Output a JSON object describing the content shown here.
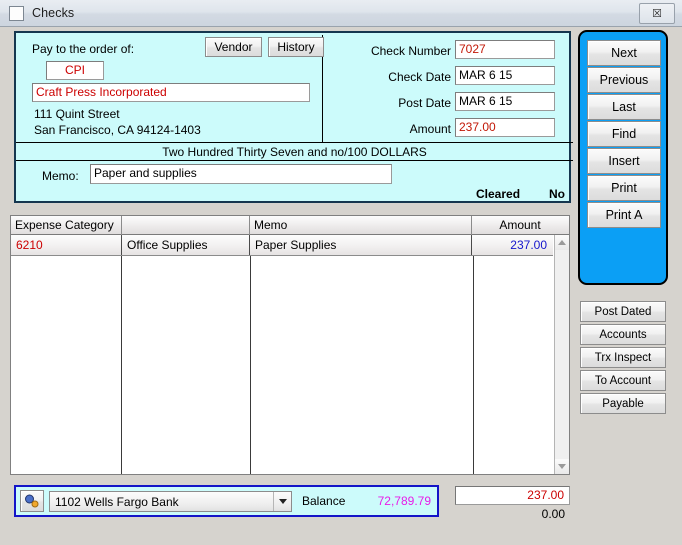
{
  "window": {
    "title": "Checks",
    "icon": "window-icon",
    "close_label": "☒"
  },
  "check": {
    "pay_to_label": "Pay to the order of:",
    "vendor_button": "Vendor",
    "history_button": "History",
    "vendor_code": "CPI",
    "payee_name": "Craft Press Incorporated",
    "address_line1": "111 Quint Street",
    "address_line2": "San Francisco, CA  94124-1403",
    "check_number_label": "Check Number",
    "check_number": "7027",
    "check_date_label": "Check Date",
    "check_date": "MAR 6 15",
    "post_date_label": "Post Date",
    "post_date": "MAR 6 15",
    "amount_label": "Amount",
    "amount": "237.00",
    "amount_words": "Two Hundred Thirty Seven and no/100 DOLLARS",
    "memo_label": "Memo:",
    "memo": "Paper and supplies",
    "cleared_label": "Cleared",
    "cleared_value": "No"
  },
  "nav_buttons": [
    {
      "label": "Next"
    },
    {
      "label": "Previous"
    },
    {
      "label": "Last"
    },
    {
      "label": "Find"
    },
    {
      "label": "Insert"
    },
    {
      "label": "Print"
    },
    {
      "label": "Print A"
    }
  ],
  "side_buttons": [
    {
      "label": "Post Dated"
    },
    {
      "label": "Accounts"
    },
    {
      "label": "Trx Inspect"
    },
    {
      "label": "To Account"
    },
    {
      "label": "Payable"
    }
  ],
  "grid": {
    "headers": [
      "Expense Category",
      "",
      "Memo",
      "Amount"
    ],
    "rows": [
      {
        "category": "6210",
        "category_name": "Office Supplies",
        "memo": "Paper Supplies",
        "amount": "237.00"
      }
    ]
  },
  "bottom": {
    "lookup_icon": "magnifier-icon",
    "account_number": "1102",
    "account_name": "Wells Fargo Bank",
    "account_display": "1102     Wells Fargo Bank",
    "dropdown_icon": "chevron-down-icon",
    "balance_label": "Balance",
    "balance_value": "72,789.79",
    "total_distributed": "237.00",
    "total_remaining": "0.00"
  },
  "colors": {
    "check_bg": "#ccfbfb",
    "nav_panel": "#0b9ff5",
    "red_text": "#cc0000",
    "blue_text": "#1515cc",
    "magenta_text": "#e81ce8"
  }
}
